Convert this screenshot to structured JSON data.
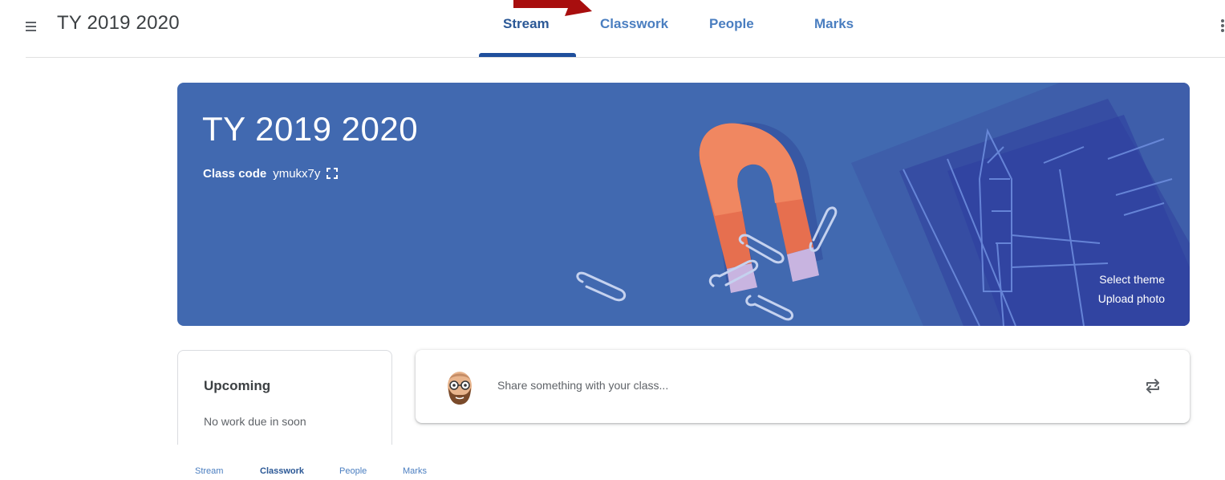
{
  "header": {
    "title": "TY 2019 2020",
    "tabs": [
      {
        "label": "Stream",
        "active": true
      },
      {
        "label": "Classwork",
        "active": false
      },
      {
        "label": "People",
        "active": false
      },
      {
        "label": "Marks",
        "active": false
      }
    ]
  },
  "banner": {
    "title": "TY 2019 2020",
    "class_code_label": "Class code",
    "class_code_value": "ymukx7y",
    "select_theme": "Select theme",
    "upload_photo": "Upload photo"
  },
  "upcoming": {
    "title": "Upcoming",
    "empty_text": "No work due in soon"
  },
  "share": {
    "placeholder": "Share something with your class..."
  },
  "footer_tabs": [
    {
      "label": "Stream",
      "active": false
    },
    {
      "label": "Classwork",
      "active": true
    },
    {
      "label": "People",
      "active": false
    },
    {
      "label": "Marks",
      "active": false
    }
  ],
  "icons": {
    "menu": "hamburger-menu-icon",
    "more": "more-vert-icon",
    "expand": "fullscreen-expand-icon",
    "repost": "repost-arrows-icon",
    "avatar": "bitmoji-avatar"
  },
  "colors": {
    "banner": "#4169b0",
    "tab_active": "#2b5896",
    "tab": "#4a7ec0",
    "annotation_arrow": "#a80e0e"
  }
}
